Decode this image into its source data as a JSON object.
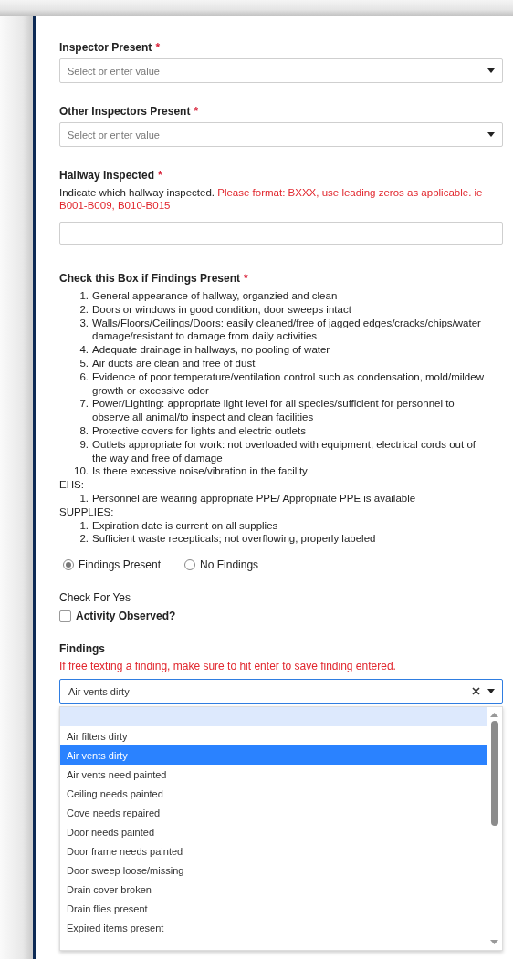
{
  "fields": [
    {
      "kind": "select",
      "label": "Inspector Present",
      "required_mark": "*",
      "placeholder": "Select or enter value"
    },
    {
      "kind": "select",
      "label": "Other Inspectors Present",
      "required_mark": "*",
      "placeholder": "Select or enter value"
    },
    {
      "kind": "text",
      "label": "Hallway Inspected",
      "required_mark": "*",
      "help": "Indicate which hallway inspected.",
      "warning": "Please format: BXXX, use leading zeros as applicable. ie B001-B009, B010-B015"
    }
  ],
  "checklist": {
    "label": "Check this Box if Findings Present",
    "required_mark": "*",
    "groups": [
      {
        "items": [
          {
            "number": "1.",
            "text": "General appearance of hallway, organzied and clean"
          },
          {
            "number": "2.",
            "text": "Doors or windows in good condition, door sweeps intact"
          },
          {
            "number": "3.",
            "text": "Walls/Floors/Ceilings/Doors: easily cleaned/free of jagged edges/cracks/chips/water damage/resistant to damage from daily activities"
          },
          {
            "number": "4.",
            "text": "Adequate drainage in hallways, no pooling of water"
          },
          {
            "number": "5.",
            "text": "Air ducts are clean and free of dust"
          },
          {
            "number": "6.",
            "text": "Evidence of poor temperature/ventilation control such as condensation, mold/mildew growth or excessive odor"
          },
          {
            "number": "7.",
            "text": "Power/Lighting: appropriate light level for all species/sufficient for personnel to observe all animal/to inspect and clean facilities"
          },
          {
            "number": "8.",
            "text": "Protective covers for lights and electric outlets"
          },
          {
            "number": "9.",
            "text": "Outlets appropriate for work: not overloaded with equipment, electrical cords out of the way and free of damage"
          },
          {
            "number": "10.",
            "text": "Is there excessive noise/vibration in the facility"
          }
        ]
      },
      {
        "heading": "EHS:",
        "items": [
          {
            "number": "1.",
            "text": "Personnel are wearing appropriate PPE/ Appropriate PPE is available"
          }
        ]
      },
      {
        "heading": "SUPPLIES:",
        "items": [
          {
            "number": "1.",
            "text": "Expiration date is current on all supplies"
          },
          {
            "number": "2.",
            "text": "Sufficient waste recepticals; not overflowing, properly labeled"
          }
        ]
      }
    ],
    "options": [
      {
        "label": "Findings Present",
        "selected": true
      },
      {
        "label": "No Findings",
        "selected": false
      }
    ]
  },
  "activity": {
    "caption": "Check For Yes",
    "label": "Activity Observed?",
    "checked": false
  },
  "findings": {
    "label": "Findings",
    "warning": "If free texting a finding, make sure to hit enter to save finding entered.",
    "value": "Air vents dirty",
    "options": [
      {
        "kind": "blank",
        "selected": false
      },
      {
        "kind": "item",
        "label": "Air filters dirty",
        "selected": false
      },
      {
        "kind": "item",
        "label": "Air vents dirty",
        "selected": true
      },
      {
        "kind": "item",
        "label": "Air vents need painted",
        "selected": false
      },
      {
        "kind": "item",
        "label": "Ceiling needs painted",
        "selected": false
      },
      {
        "kind": "item",
        "label": "Cove needs repaired",
        "selected": false
      },
      {
        "kind": "item",
        "label": "Door needs painted",
        "selected": false
      },
      {
        "kind": "item",
        "label": "Door frame needs painted",
        "selected": false
      },
      {
        "kind": "item",
        "label": "Door sweep loose/missing",
        "selected": false
      },
      {
        "kind": "item",
        "label": "Drain cover broken",
        "selected": false
      },
      {
        "kind": "item",
        "label": "Drain flies present",
        "selected": false
      },
      {
        "kind": "item",
        "label": "Expired items present",
        "selected": false
      }
    ]
  }
}
